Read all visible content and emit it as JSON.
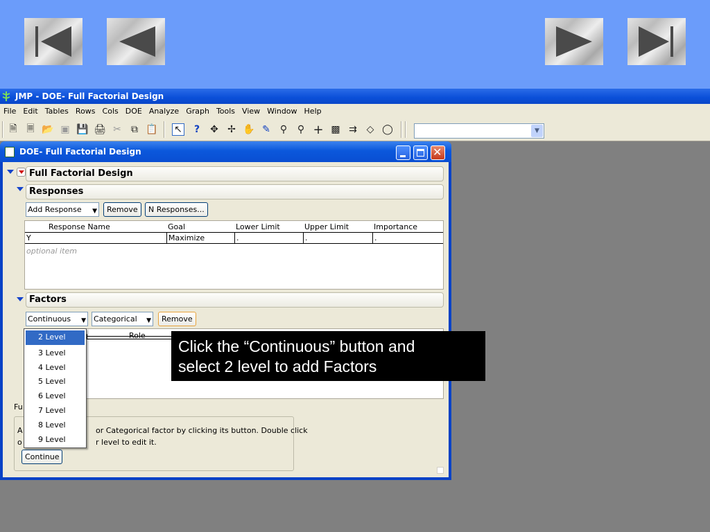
{
  "nav": {
    "first": "first-slide",
    "prev": "previous-slide",
    "next": "next-slide",
    "last": "last-slide"
  },
  "app": {
    "title": "JMP - DOE- Full Factorial Design",
    "menus": [
      "File",
      "Edit",
      "Tables",
      "Rows",
      "Cols",
      "DOE",
      "Analyze",
      "Graph",
      "Tools",
      "View",
      "Window",
      "Help"
    ],
    "toolbar_combo_value": ""
  },
  "window": {
    "title": "DOE- Full Factorial Design",
    "outline_title": "Full Factorial Design",
    "responses": {
      "title": "Responses",
      "add_response": "Add Response",
      "remove": "Remove",
      "n_responses": "N Responses...",
      "columns": [
        "Response Name",
        "Goal",
        "Lower Limit",
        "Upper Limit",
        "Importance"
      ],
      "rows": [
        {
          "name": "Y",
          "goal": "Maximize",
          "lower": ".",
          "upper": ".",
          "importance": "."
        }
      ],
      "optional_item": "optional item"
    },
    "factors": {
      "title": "Factors",
      "continuous": "Continuous",
      "categorical": "Categorical",
      "remove": "Remove",
      "role_header": "Role",
      "dropdown_items": [
        "2 Level",
        "3 Level",
        "4 Level",
        "5 Level",
        "6 Level",
        "7 Level",
        "8 Level",
        "9 Level"
      ],
      "selected_item": "2 Level"
    },
    "footer": {
      "label_fragment": "Fu",
      "line1_left": "A",
      "line1_right": "or Categorical factor by clicking its button. Double click",
      "line2_left": "o",
      "line2_right": "r level to edit it.",
      "continue": "Continue"
    }
  },
  "callout": {
    "line1": "Click the “Continuous” button and",
    "line2": "select 2 level to add Factors"
  }
}
